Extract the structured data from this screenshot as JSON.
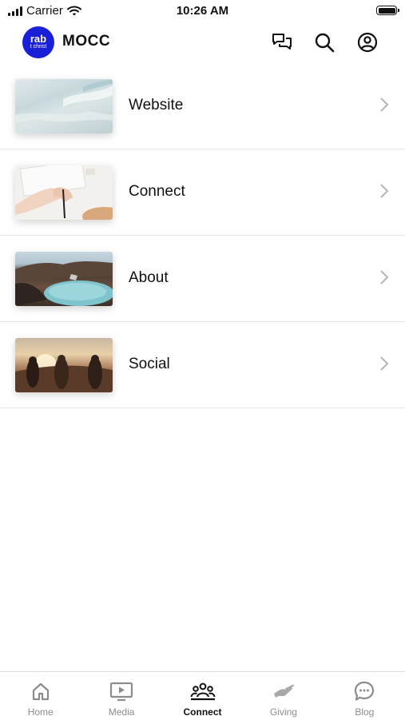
{
  "status_bar": {
    "carrier": "Carrier",
    "time": "10:26 AM",
    "battery_level": 1.0
  },
  "header": {
    "title": "MOCC",
    "logo_line1": "rab",
    "logo_line2": "t christ",
    "brand_color": "#1a1fd8",
    "icons": [
      "chat-icon",
      "search-icon",
      "account-icon"
    ]
  },
  "menu": {
    "items": [
      {
        "label": "Website",
        "thumbnail": "ocean-water"
      },
      {
        "label": "Connect",
        "thumbnail": "hands-keyboard"
      },
      {
        "label": "About",
        "thumbnail": "crater-lake"
      },
      {
        "label": "Social",
        "thumbnail": "friends-sunset"
      }
    ]
  },
  "tabbar": {
    "active": "Connect",
    "tabs": [
      {
        "label": "Home",
        "icon": "home-icon"
      },
      {
        "label": "Media",
        "icon": "media-icon"
      },
      {
        "label": "Connect",
        "icon": "people-icon"
      },
      {
        "label": "Giving",
        "icon": "giving-hand-icon"
      },
      {
        "label": "Blog",
        "icon": "blog-bubble-icon"
      }
    ]
  }
}
